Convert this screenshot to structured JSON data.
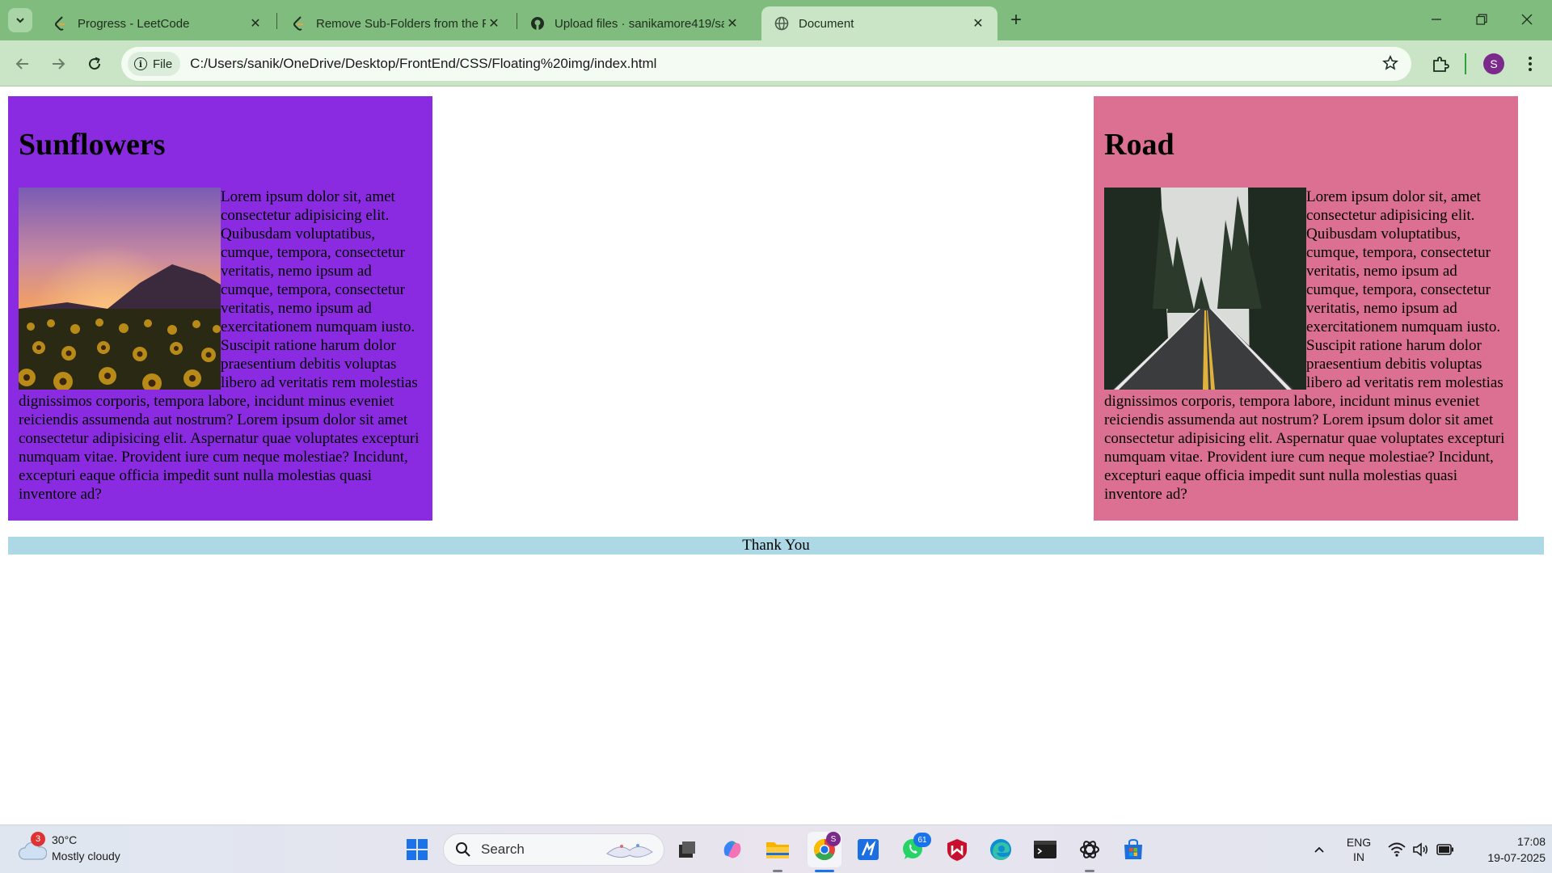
{
  "browser": {
    "tabs": [
      {
        "title": "Progress - LeetCode",
        "icon": "leetcode-icon",
        "active": false
      },
      {
        "title": "Remove Sub-Folders from the F",
        "icon": "leetcode-icon",
        "active": false
      },
      {
        "title": "Upload files · sanikamore419/sa",
        "icon": "github-icon",
        "active": false
      },
      {
        "title": "Document",
        "icon": "globe-icon",
        "active": true
      }
    ],
    "chip_label": "File",
    "url": "C:/Users/sanik/OneDrive/Desktop/FrontEnd/CSS/Floating%20img/index.html",
    "profile_initial": "S"
  },
  "page": {
    "cards": [
      {
        "heading": "Sunflowers",
        "image": "sunflower-field-at-sunset",
        "text": "Lorem ipsum dolor sit, amet consectetur adipisicing elit. Quibusdam voluptatibus, cumque, tempora, consectetur veritatis, nemo ipsum ad cumque, tempora, consectetur veritatis, nemo ipsum ad exercitationem numquam iusto. Suscipit ratione harum dolor praesentium debitis voluptas libero ad veritatis rem molestias dignissimos corporis, tempora labore, incidunt minus eveniet reiciendis assumenda aut nostrum? Lorem ipsum dolor sit amet consectetur adipisicing elit. Aspernatur quae voluptates excepturi numquam vitae. Provident iure cum neque molestiae? Incidunt, excepturi eaque officia impedit sunt nulla molestias quasi inventore ad?",
        "background": "#8a2be2"
      },
      {
        "heading": "Road",
        "image": "forest-road",
        "text": "Lorem ipsum dolor sit, amet consectetur adipisicing elit. Quibusdam voluptatibus, cumque, tempora, consectetur veritatis, nemo ipsum ad cumque, tempora, consectetur veritatis, nemo ipsum ad exercitationem numquam iusto. Suscipit ratione harum dolor praesentium debitis voluptas libero ad veritatis rem molestias dignissimos corporis, tempora labore, incidunt minus eveniet reiciendis assumenda aut nostrum? Lorem ipsum dolor sit amet consectetur adipisicing elit. Aspernatur quae voluptates excepturi numquam vitae. Provident iure cum neque molestiae? Incidunt, excepturi eaque officia impedit sunt nulla molestias quasi inventore ad?",
        "background": "#db7093"
      }
    ],
    "footer": "Thank You",
    "footer_background": "#add8e6"
  },
  "taskbar": {
    "weather": {
      "temp": "30°C",
      "condition": "Mostly cloudy",
      "badge": "3"
    },
    "search_label": "Search",
    "chrome_badge": "S",
    "whatsapp_badge": "61",
    "language": "ENG",
    "region": "IN",
    "time": "17:08",
    "date": "19-07-2025"
  },
  "colors": {
    "tabstrip": "#7fbc7d",
    "toolbar": "#c9e5c6"
  }
}
